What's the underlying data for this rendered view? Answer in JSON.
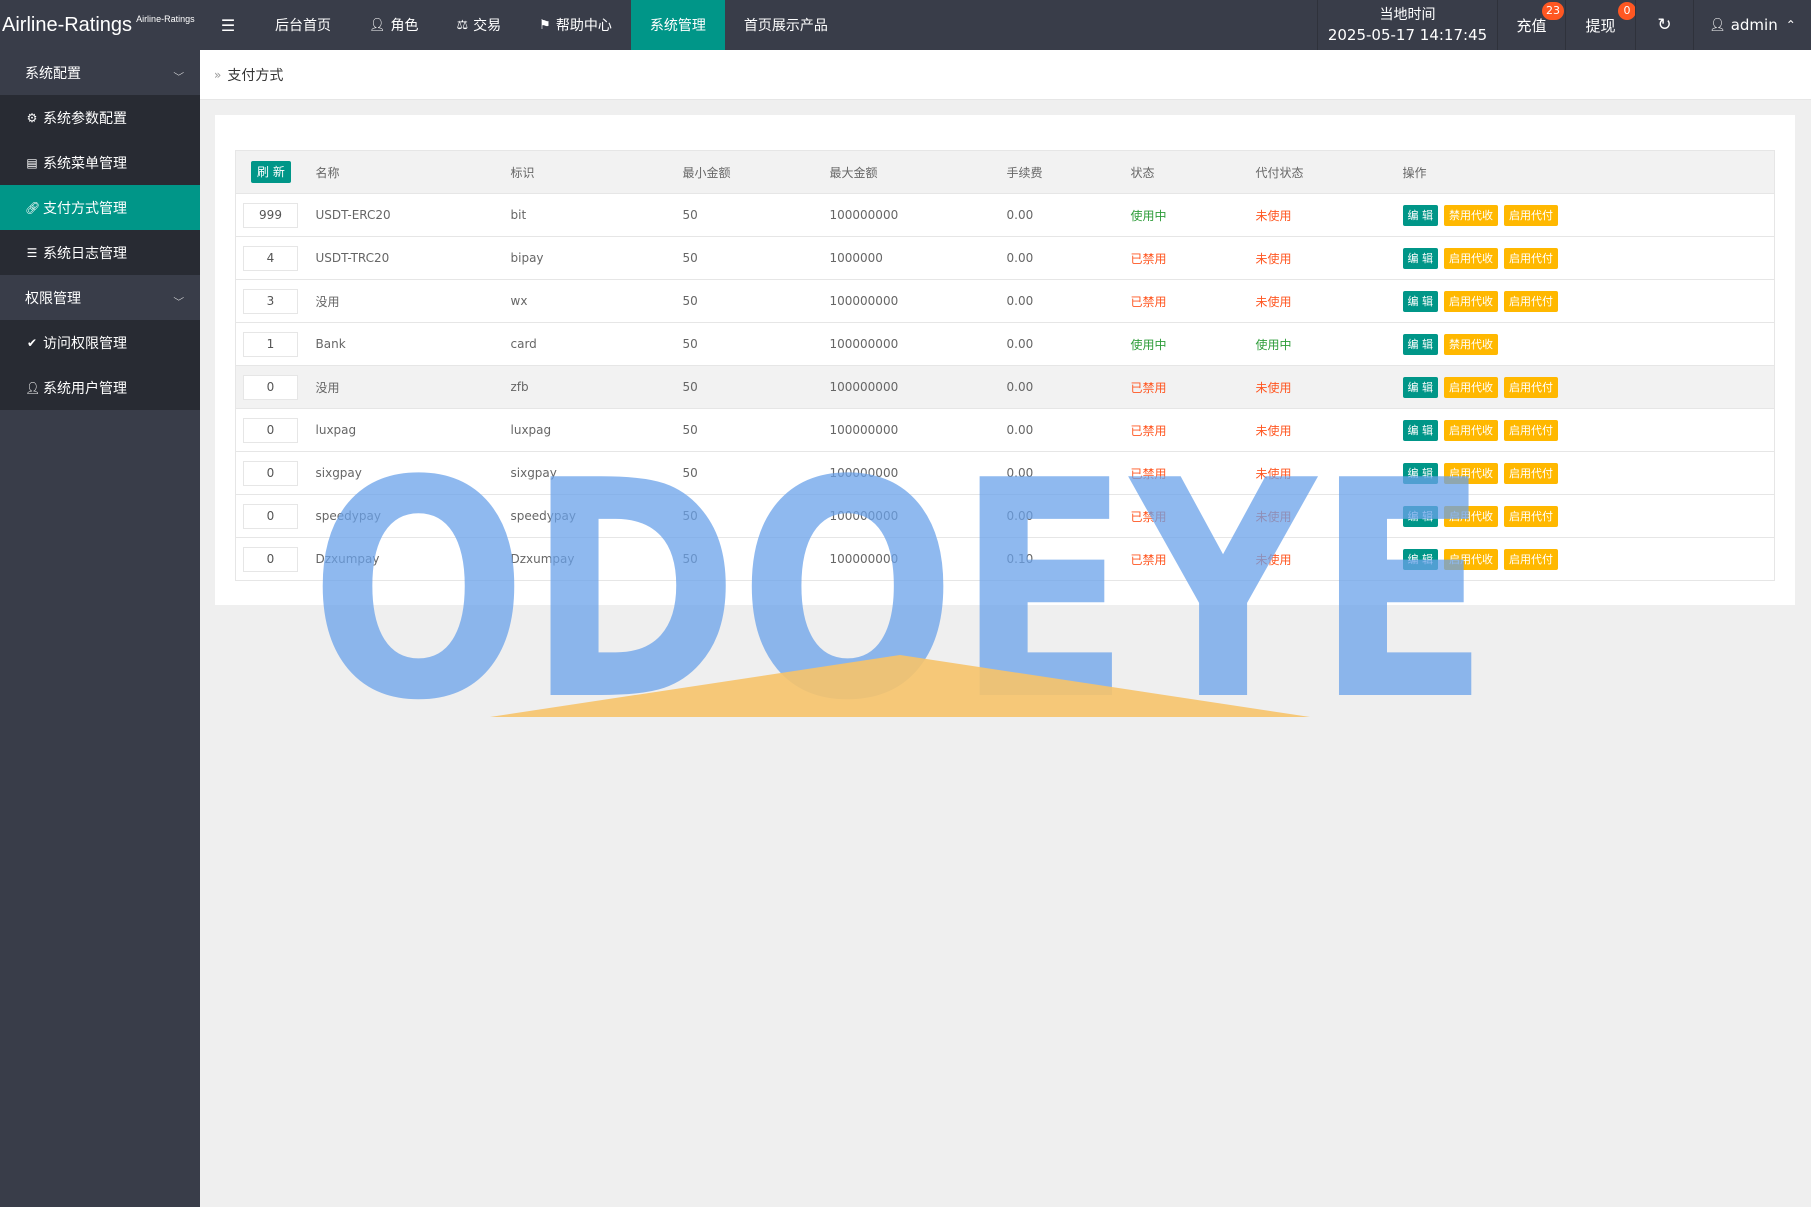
{
  "app": {
    "title": "Airline-Ratings",
    "subtitle": "Airline-Ratings"
  },
  "topnav": {
    "items": [
      {
        "label": "后台首页",
        "icon": ""
      },
      {
        "label": "角色",
        "icon": "user-icon"
      },
      {
        "label": "交易",
        "icon": "scale-icon"
      },
      {
        "label": "帮助中心",
        "icon": "flag-icon"
      },
      {
        "label": "系统管理",
        "icon": "",
        "active": true
      },
      {
        "label": "首页展示产品",
        "icon": ""
      }
    ],
    "time_label": "当地时间",
    "time_value": "2025-05-17 14:17:45",
    "recharge_label": "充值",
    "recharge_count": "23",
    "withdraw_label": "提现",
    "withdraw_count": "0",
    "admin_label": "admin"
  },
  "sidebar": {
    "groups": [
      {
        "label": "系统配置",
        "items": [
          {
            "label": "系统参数配置",
            "icon": "gear-icon"
          },
          {
            "label": "系统菜单管理",
            "icon": "window-icon"
          },
          {
            "label": "支付方式管理",
            "icon": "link-icon",
            "active": true
          },
          {
            "label": "系统日志管理",
            "icon": "log-icon"
          }
        ]
      },
      {
        "label": "权限管理",
        "items": [
          {
            "label": "访问权限管理",
            "icon": "shield-check-icon"
          },
          {
            "label": "系统用户管理",
            "icon": "user-icon"
          }
        ]
      }
    ]
  },
  "breadcrumb": {
    "current": "支付方式"
  },
  "table": {
    "refresh_label": "刷 新",
    "headers": [
      "名称",
      "标识",
      "最小金额",
      "最大金额",
      "手续费",
      "状态",
      "代付状态",
      "操作"
    ],
    "edit_label": "编 辑",
    "rows": [
      {
        "sort": "999",
        "name": "USDT-ERC20",
        "code": "bit",
        "min": "50",
        "max": "100000000",
        "fee": "0.00",
        "status": "使用中",
        "status_type": "on",
        "payout": "未使用",
        "payout_type": "off",
        "actions": [
          "禁用代收",
          "启用代付"
        ]
      },
      {
        "sort": "4",
        "name": "USDT-TRC20",
        "code": "bipay",
        "min": "50",
        "max": "1000000",
        "fee": "0.00",
        "status": "已禁用",
        "status_type": "off",
        "payout": "未使用",
        "payout_type": "off",
        "actions": [
          "启用代收",
          "启用代付"
        ]
      },
      {
        "sort": "3",
        "name": "没用",
        "code": "wx",
        "min": "50",
        "max": "100000000",
        "fee": "0.00",
        "status": "已禁用",
        "status_type": "off",
        "payout": "未使用",
        "payout_type": "off",
        "actions": [
          "启用代收",
          "启用代付"
        ]
      },
      {
        "sort": "1",
        "name": "Bank",
        "code": "card",
        "min": "50",
        "max": "100000000",
        "fee": "0.00",
        "status": "使用中",
        "status_type": "on",
        "payout": "使用中",
        "payout_type": "on",
        "actions": [
          "禁用代收"
        ]
      },
      {
        "sort": "0",
        "name": "没用",
        "code": "zfb",
        "min": "50",
        "max": "100000000",
        "fee": "0.00",
        "status": "已禁用",
        "status_type": "off",
        "payout": "未使用",
        "payout_type": "off",
        "actions": [
          "启用代收",
          "启用代付"
        ],
        "highlight": true
      },
      {
        "sort": "0",
        "name": "luxpag",
        "code": "luxpag",
        "min": "50",
        "max": "100000000",
        "fee": "0.00",
        "status": "已禁用",
        "status_type": "off",
        "payout": "未使用",
        "payout_type": "off",
        "actions": [
          "启用代收",
          "启用代付"
        ]
      },
      {
        "sort": "0",
        "name": "sixgpay",
        "code": "sixgpay",
        "min": "50",
        "max": "100000000",
        "fee": "0.00",
        "status": "已禁用",
        "status_type": "off",
        "payout": "未使用",
        "payout_type": "off",
        "actions": [
          "启用代收",
          "启用代付"
        ]
      },
      {
        "sort": "0",
        "name": "speedypay",
        "code": "speedypay",
        "min": "50",
        "max": "100000000",
        "fee": "0.00",
        "status": "已禁用",
        "status_type": "off",
        "payout": "未使用",
        "payout_type": "off",
        "actions": [
          "启用代收",
          "启用代付"
        ]
      },
      {
        "sort": "0",
        "name": "Dzxumpay",
        "code": "Dzxumpay",
        "min": "50",
        "max": "100000000",
        "fee": "0.10",
        "status": "已禁用",
        "status_type": "off",
        "payout": "未使用",
        "payout_type": "off",
        "actions": [
          "启用代收",
          "启用代付"
        ]
      }
    ]
  },
  "watermark": {
    "text": "ODOEYE"
  },
  "colors": {
    "accent": "#009688",
    "warn": "#ffb800",
    "danger": "#ff5722",
    "dark": "#393d49",
    "darker": "#282b33",
    "success": "#5fb878"
  }
}
